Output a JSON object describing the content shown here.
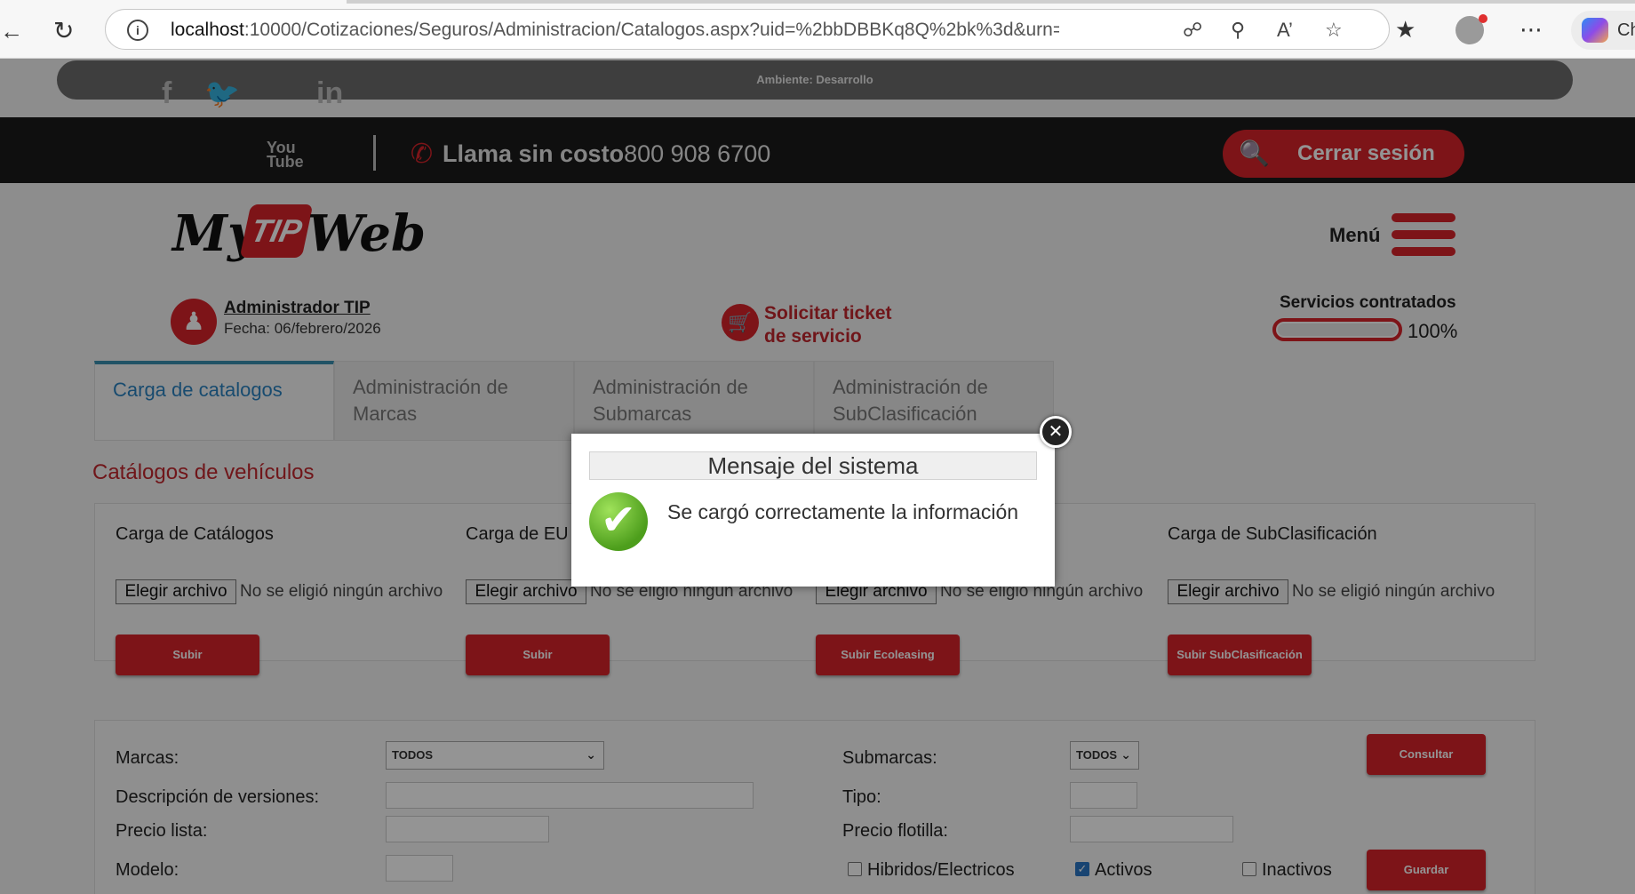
{
  "browser": {
    "url_host": "localhost",
    "url_rest": ":10000/Cotizaciones/Seguros/Administracion/Catalogos.aspx?uid=%2bbDBBKq8Q%2bk%3d&urn=Dqf6S...",
    "copilot_label": "Ch"
  },
  "env": {
    "label": "Ambiente: Desarrollo"
  },
  "topbar": {
    "call_label": "Llama sin costo",
    "phone": "800 908 6700",
    "logout_label": "Cerrar sesión"
  },
  "brand": {
    "part1": "My",
    "part2": "TIP",
    "part3": "Web"
  },
  "menu": {
    "label": "Menú"
  },
  "user": {
    "name": "Administrador TIP",
    "date": "Fecha: 06/febrero/2026"
  },
  "ticket": {
    "line1": "Solicitar ticket",
    "line2": "de servicio"
  },
  "services": {
    "label": "Servicios contratados",
    "percent": "100%",
    "fraction": 1.0
  },
  "tabs": [
    {
      "label": "Carga de catalogos"
    },
    {
      "label": "Administración de Marcas"
    },
    {
      "label": "Administración de Submarcas"
    },
    {
      "label": "Administración de SubClasificación"
    }
  ],
  "catalogs": {
    "title": "Catálogos de vehículos",
    "columns": [
      {
        "title": "Carga de Catálogos",
        "file_button": "Elegir archivo",
        "file_text": "No se eligió ningún archivo",
        "upload": "Subir"
      },
      {
        "title": "Carga de EU",
        "file_button": "Elegir archivo",
        "file_text": "No se eligió ningún archivo",
        "upload": "Subir"
      },
      {
        "title": "",
        "file_button": "Elegir archivo",
        "file_text": "No se eligió ningún archivo",
        "upload": "Subir Ecoleasing"
      },
      {
        "title": "Carga de SubClasificación",
        "file_button": "Elegir archivo",
        "file_text": "No se eligió ningún archivo",
        "upload": "Subir SubClasificación"
      }
    ]
  },
  "filters": {
    "marcas_label": "Marcas:",
    "marcas_value": "TODOS",
    "submarcas_label": "Submarcas:",
    "submarcas_value": "TODOS",
    "consultar": "Consultar",
    "descripcion_label": "Descripción de versiones:",
    "tipo_label": "Tipo:",
    "precio_lista_label": "Precio lista:",
    "precio_flotilla_label": "Precio flotilla:",
    "modelo_label": "Modelo:",
    "hibridos_label": "Hibridos/Electricos",
    "activos_label": "Activos",
    "inactivos_label": "Inactivos",
    "guardar": "Guardar"
  },
  "modal": {
    "title": "Mensaje del sistema",
    "message": "Se cargó correctamente la información"
  }
}
